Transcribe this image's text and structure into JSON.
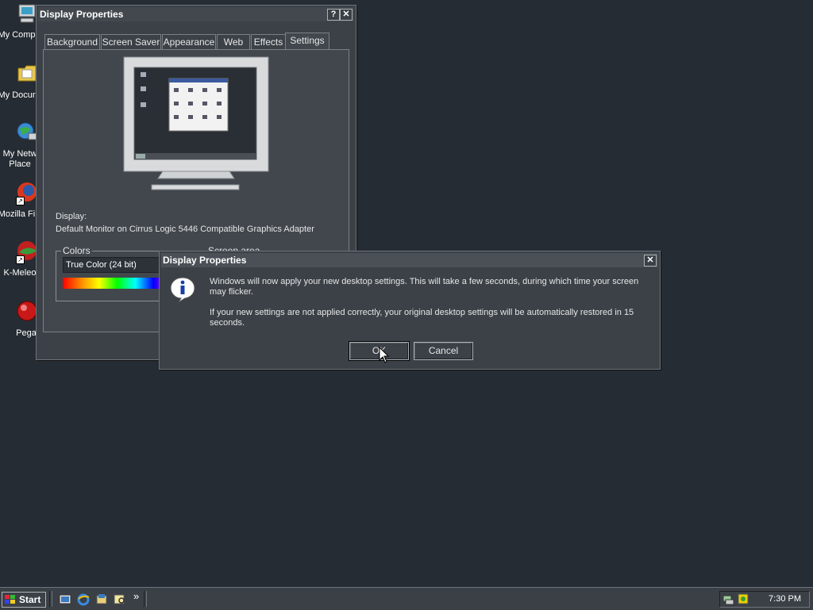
{
  "desktop": {
    "icons": [
      {
        "label": "My Comp",
        "icon": "computer-icon"
      },
      {
        "label": "My Docur",
        "icon": "folder-icon"
      },
      {
        "label": "My Netw\nPlace",
        "icon": "network-icon"
      },
      {
        "label": "Mozilla Fi",
        "icon": "firefox-icon"
      },
      {
        "label": "K-Meleo",
        "icon": "kmeleon-icon"
      },
      {
        "label": "Pega",
        "icon": "pegasus-icon"
      }
    ]
  },
  "display_properties": {
    "title": "Display Properties",
    "help_label": "?",
    "close_label": "✕",
    "tabs": [
      "Background",
      "Screen Saver",
      "Appearance",
      "Web",
      "Effects",
      "Settings"
    ],
    "active_tab": "Settings",
    "display_label": "Display:",
    "display_value": "Default Monitor on Cirrus Logic 5446 Compatible Graphics Adapter",
    "colors_label": "Colors",
    "colors_value": "True Color (24 bit)",
    "screen_area_label": "Screen area"
  },
  "dialog": {
    "title": "Display Properties",
    "close_label": "✕",
    "message1": "Windows will now apply your new desktop settings. This will take a few seconds, during which time your screen may flicker.",
    "message2": "If your new settings are not applied correctly, your original desktop settings will be automatically restored in 15 seconds.",
    "ok_label": "OK",
    "cancel_label": "Cancel",
    "icon": "info-icon"
  },
  "taskbar": {
    "start_label": "Start",
    "quick_launch": [
      "show-desktop-icon",
      "ie-icon",
      "explorer-icon",
      "search-icon"
    ],
    "chevron": "»",
    "clock": "7:30 PM"
  },
  "colors": {
    "desktop": "#262c33",
    "window": "#3b4147",
    "text": "#e6e6e6"
  }
}
